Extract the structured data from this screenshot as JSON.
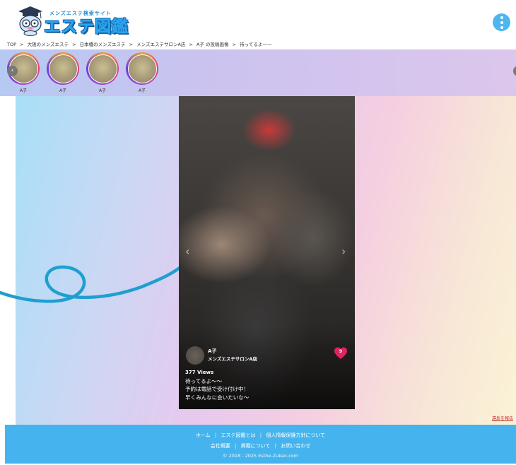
{
  "header": {
    "logo_tagline": "メンズエステ検索サイト",
    "logo_title": "エステ図鑑",
    "menu_icon": "kebab-menu-icon"
  },
  "breadcrumb": {
    "items": [
      "TOP",
      ">",
      "大阪のメンズエステ",
      ">",
      "日本橋のメンズエステ",
      ">",
      "メンズエステサロンA店",
      ">",
      "A子 の投稿画像",
      ">",
      "待ってるよ〜〜"
    ]
  },
  "stories": {
    "items": [
      {
        "label": "A子"
      },
      {
        "label": "A子"
      },
      {
        "label": "A子"
      },
      {
        "label": "A子"
      }
    ],
    "prev_icon": "‹",
    "next_icon": "›"
  },
  "post": {
    "author_name": "A子",
    "shop_name": "メンズエステサロンA店",
    "like_count": "9",
    "views": "377 Views",
    "caption_lines": [
      "待ってるよ〜〜",
      "予約は電話で受け付け中！",
      "早くみんなに会いたいな〜"
    ],
    "prev_chevron": "‹",
    "next_chevron": "›"
  },
  "report_link": "違反を報告",
  "footer": {
    "row1": [
      "ホーム",
      "エステ図鑑とは",
      "個人情報保護方針について"
    ],
    "row2": [
      "会社概要",
      "掲載について",
      "お問い合わせ"
    ],
    "copyright": "© 2018 - 2025 Esthe-Zukan.com",
    "separator": "|"
  },
  "colors": {
    "accent": "#45b4ee",
    "like": "#e0245e",
    "logo_blue": "#2aa6ee"
  }
}
